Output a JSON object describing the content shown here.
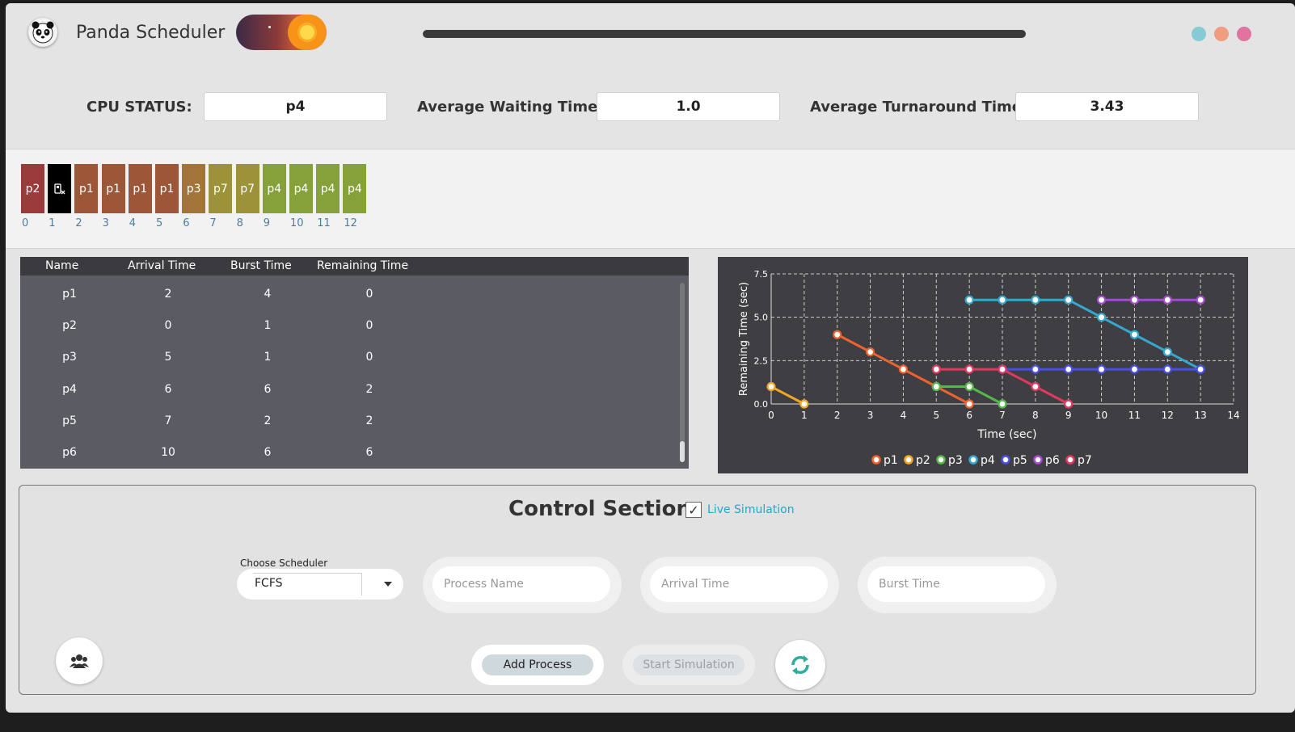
{
  "app": {
    "title": "Panda Scheduler",
    "logo_icon": "panda-icon"
  },
  "theme_toggle": {
    "mode": "day",
    "knob_icon": "sun-icon"
  },
  "window_dots": [
    "#86cad6",
    "#ef9c7f",
    "#e173a0"
  ],
  "stats": {
    "cpu_label": "CPU STATUS:",
    "cpu_value": "p4",
    "awt_label": "Average Waiting Time:",
    "awt_value": "1.0",
    "att_label": "Average Turnaround Time:",
    "att_value": "3.43"
  },
  "gantt": {
    "blocks": [
      {
        "label": "p2",
        "color": "#9a3b3b"
      },
      {
        "label": "",
        "color": "#000000",
        "icon": "idle-cpu-icon"
      },
      {
        "label": "p1",
        "color": "#9c5638"
      },
      {
        "label": "p1",
        "color": "#9c5638"
      },
      {
        "label": "p1",
        "color": "#9c5638"
      },
      {
        "label": "p1",
        "color": "#9c5638"
      },
      {
        "label": "p3",
        "color": "#a1743a"
      },
      {
        "label": "p7",
        "color": "#9c923a"
      },
      {
        "label": "p7",
        "color": "#9c923a"
      },
      {
        "label": "p4",
        "color": "#86a03a"
      },
      {
        "label": "p4",
        "color": "#86a03a"
      },
      {
        "label": "p4",
        "color": "#86a03a"
      },
      {
        "label": "p4",
        "color": "#86a03a"
      }
    ],
    "ticks": [
      "0",
      "1",
      "2",
      "3",
      "4",
      "5",
      "6",
      "7",
      "8",
      "9",
      "10",
      "11",
      "12"
    ]
  },
  "table": {
    "headers": [
      "Name",
      "Arrival Time",
      "Burst Time",
      "Remaining Time"
    ],
    "rows": [
      [
        "p1",
        "2",
        "4",
        "0"
      ],
      [
        "p2",
        "0",
        "1",
        "0"
      ],
      [
        "p3",
        "5",
        "1",
        "0"
      ],
      [
        "p4",
        "6",
        "6",
        "2"
      ],
      [
        "p5",
        "7",
        "2",
        "2"
      ],
      [
        "p6",
        "10",
        "6",
        "6"
      ]
    ]
  },
  "chart_data": {
    "type": "line",
    "xlabel": "Time (sec)",
    "ylabel": "Remaining Time (sec)",
    "xlim": [
      0,
      14
    ],
    "ylim": [
      0,
      7.5
    ],
    "xticks": [
      "0",
      "1",
      "2",
      "3",
      "4",
      "5",
      "6",
      "7",
      "8",
      "9",
      "10",
      "11",
      "12",
      "13",
      "14"
    ],
    "yticks": [
      "0.0",
      "2.5",
      "5.0",
      "7.5"
    ],
    "grid": true,
    "legend_position": "bottom",
    "series": [
      {
        "name": "p1",
        "color": "#f0632f",
        "points": [
          [
            2,
            4
          ],
          [
            3,
            3
          ],
          [
            4,
            2
          ],
          [
            5,
            1
          ],
          [
            6,
            0
          ]
        ]
      },
      {
        "name": "p2",
        "color": "#f5a623",
        "points": [
          [
            0,
            1
          ],
          [
            1,
            0
          ]
        ]
      },
      {
        "name": "p3",
        "color": "#55b84a",
        "points": [
          [
            5,
            1
          ],
          [
            6,
            1
          ],
          [
            7,
            0
          ]
        ]
      },
      {
        "name": "p4",
        "color": "#35a8cf",
        "points": [
          [
            6,
            6
          ],
          [
            7,
            6
          ],
          [
            8,
            6
          ],
          [
            9,
            6
          ],
          [
            10,
            5
          ],
          [
            11,
            4
          ],
          [
            12,
            3
          ],
          [
            13,
            2
          ]
        ]
      },
      {
        "name": "p5",
        "color": "#4a4fe0",
        "points": [
          [
            7,
            2
          ],
          [
            8,
            2
          ],
          [
            9,
            2
          ],
          [
            10,
            2
          ],
          [
            11,
            2
          ],
          [
            12,
            2
          ],
          [
            13,
            2
          ]
        ]
      },
      {
        "name": "p6",
        "color": "#a64ad0",
        "points": [
          [
            10,
            6
          ],
          [
            11,
            6
          ],
          [
            12,
            6
          ],
          [
            13,
            6
          ]
        ]
      },
      {
        "name": "p7",
        "color": "#e03a62",
        "points": [
          [
            5,
            2
          ],
          [
            6,
            2
          ],
          [
            7,
            2
          ],
          [
            8,
            1
          ],
          [
            9,
            0
          ]
        ]
      }
    ]
  },
  "control": {
    "title": "Control Section",
    "live_checked": true,
    "live_check_glyph": "✓",
    "live_label": "Live Simulation",
    "scheduler_label": "Choose Scheduler",
    "scheduler_value": "FCFS",
    "process_name_placeholder": "Process Name",
    "arrival_time_placeholder": "Arrival Time",
    "burst_time_placeholder": "Burst Time",
    "add_label": "Add Process",
    "start_label": "Start Simulation",
    "users_icon": "users-icon",
    "reset_icon": "refresh-icon"
  }
}
